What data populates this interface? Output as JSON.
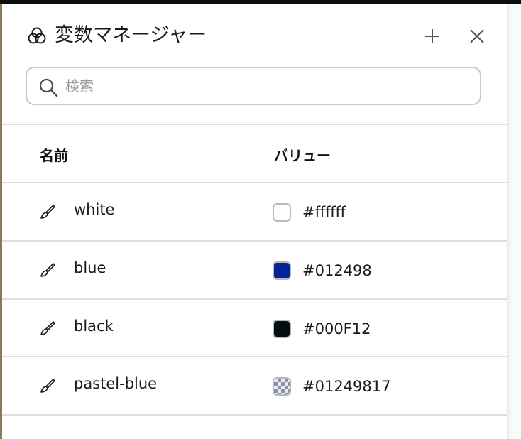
{
  "panel": {
    "title": "変数マネージャー",
    "title_icon": "variables-icon",
    "add_icon": "plus-icon",
    "close_icon": "close-icon"
  },
  "search": {
    "placeholder": "検索",
    "value": ""
  },
  "table": {
    "columns": {
      "name": "名前",
      "value": "バリュー"
    },
    "rows": [
      {
        "name": "white",
        "value": "#ffffff",
        "swatch_color": "#ffffff",
        "icon": "brush-icon"
      },
      {
        "name": "blue",
        "value": "#012498",
        "swatch_color": "#012498",
        "icon": "brush-icon"
      },
      {
        "name": "black",
        "value": "#000F12",
        "swatch_color": "#000F12",
        "icon": "brush-icon"
      },
      {
        "name": "pastel-blue",
        "value": "#01249817",
        "swatch_color": "#01249817",
        "icon": "brush-icon"
      }
    ]
  }
}
